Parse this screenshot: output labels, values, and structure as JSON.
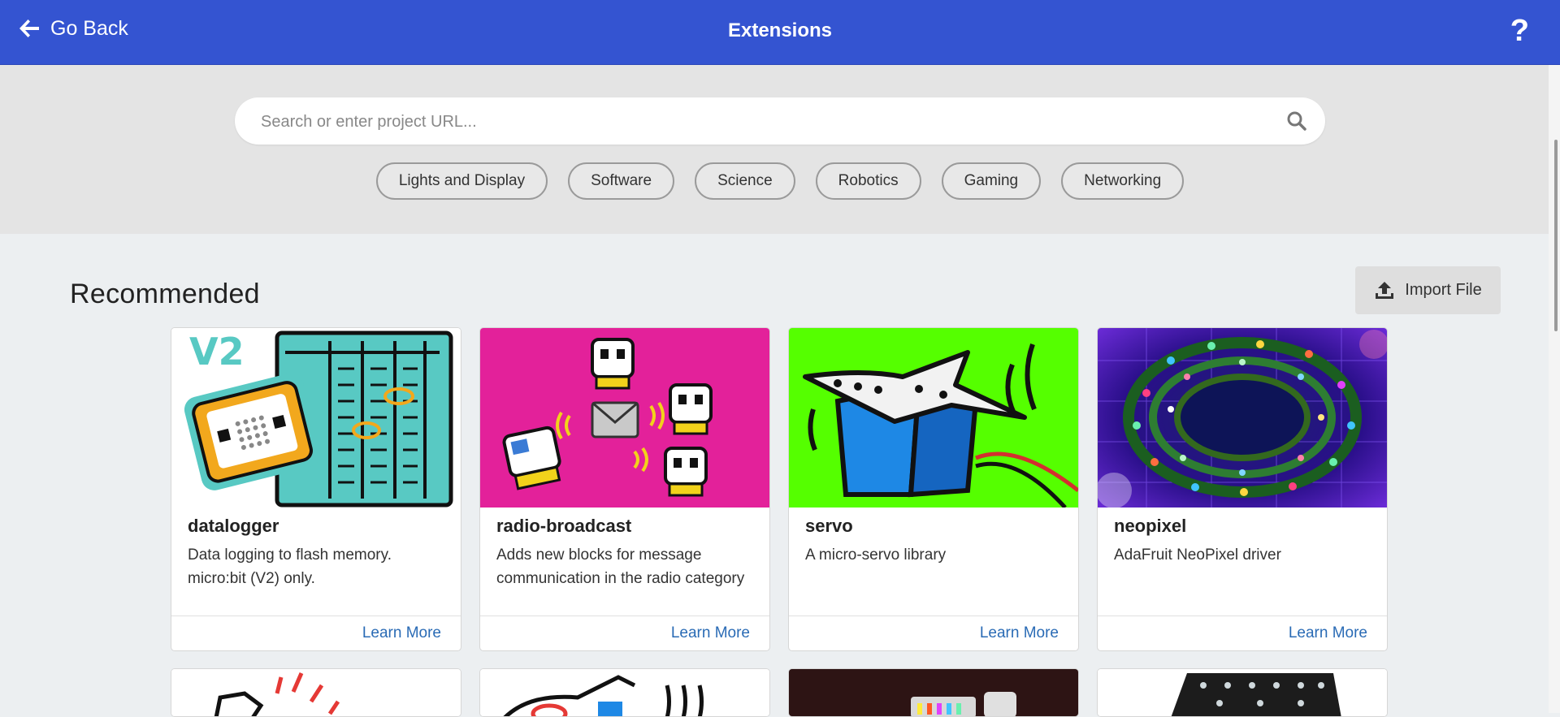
{
  "header": {
    "back_label": "Go Back",
    "title": "Extensions",
    "help_label": "?"
  },
  "search": {
    "placeholder": "Search or enter project URL..."
  },
  "categories": [
    "Lights and Display",
    "Software",
    "Science",
    "Robotics",
    "Gaming",
    "Networking"
  ],
  "section": {
    "title": "Recommended",
    "import_label": "Import File"
  },
  "cards": [
    {
      "name": "datalogger",
      "description": "Data logging to flash memory. micro:bit (V2) only.",
      "learn_more": "Learn More"
    },
    {
      "name": "radio-broadcast",
      "description": "Adds new blocks for message communication in the radio category",
      "learn_more": "Learn More"
    },
    {
      "name": "servo",
      "description": "A micro-servo library",
      "learn_more": "Learn More"
    },
    {
      "name": "neopixel",
      "description": "AdaFruit NeoPixel driver",
      "learn_more": "Learn More"
    }
  ],
  "colors": {
    "header_bg": "#3454d1",
    "search_band_bg": "#e4e4e4",
    "page_bg": "#eceff1",
    "link": "#2a6bb5"
  },
  "image_text": {
    "datalogger_badge": "V2"
  }
}
